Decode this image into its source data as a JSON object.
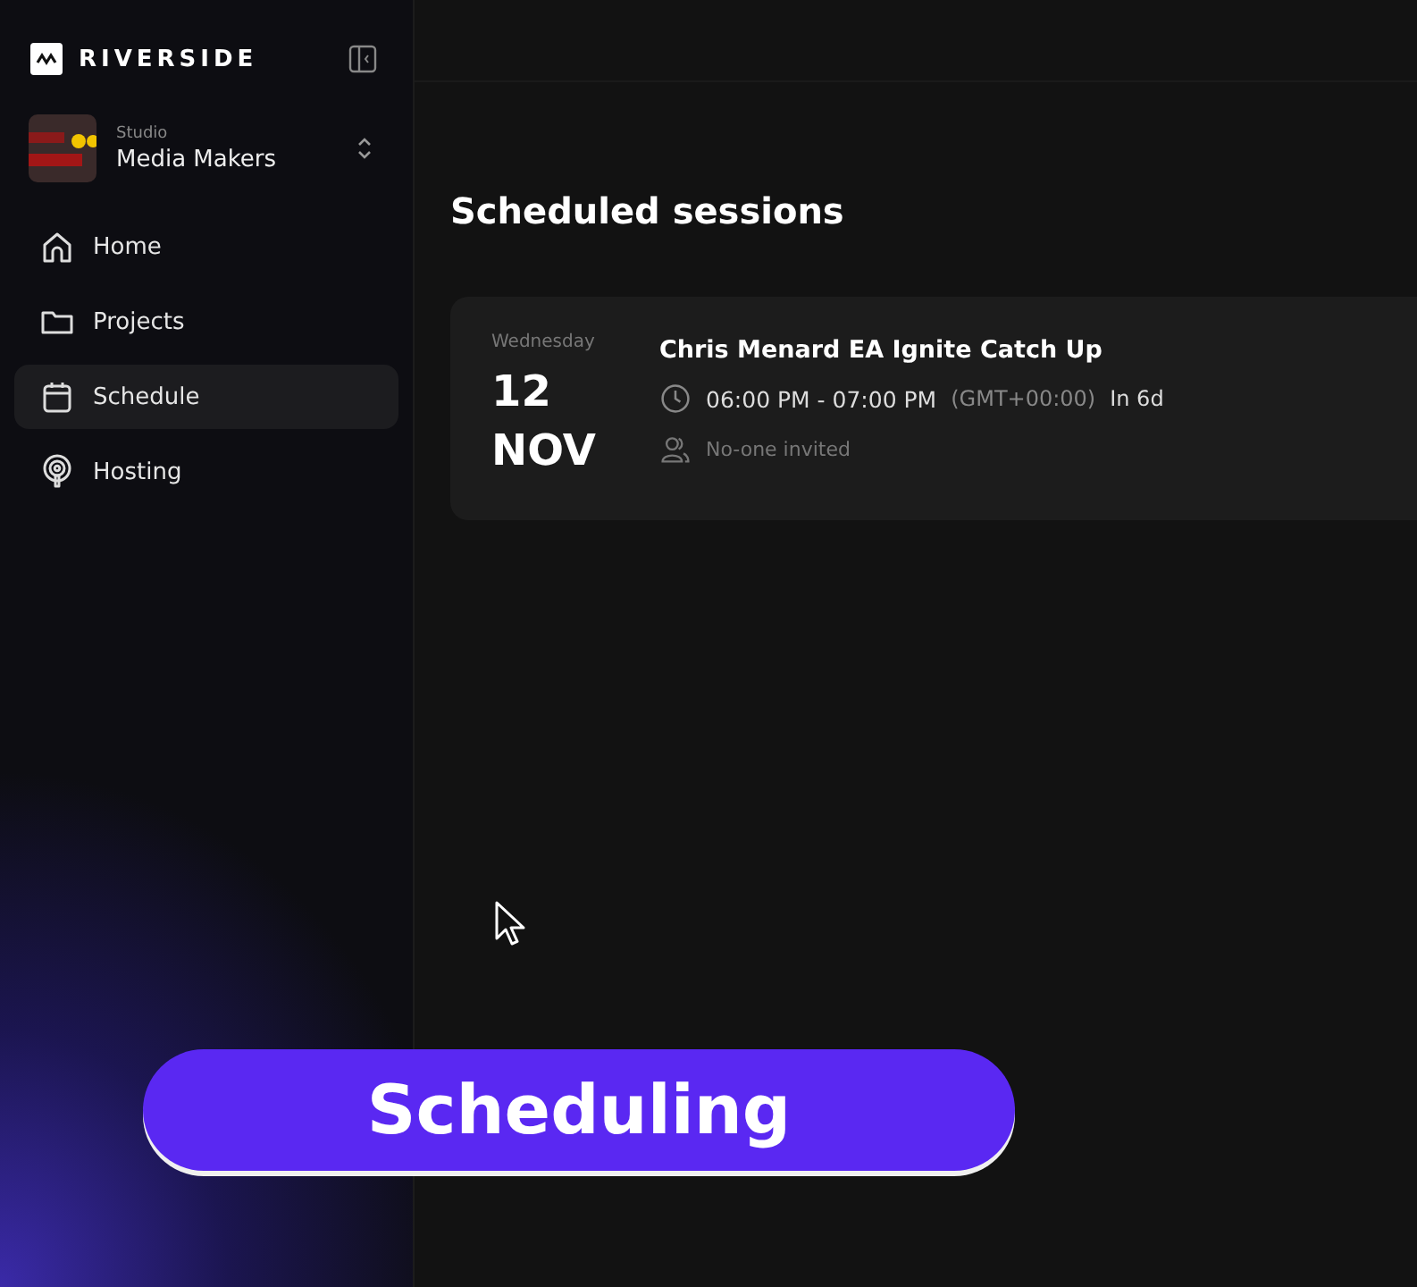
{
  "brand": {
    "name": "RIVERSIDE"
  },
  "studio": {
    "label": "Studio",
    "name": "Media Makers"
  },
  "nav": [
    {
      "label": "Home",
      "selected": false
    },
    {
      "label": "Projects",
      "selected": false
    },
    {
      "label": "Schedule",
      "selected": true
    },
    {
      "label": "Hosting",
      "selected": false
    }
  ],
  "page": {
    "title": "Scheduled sessions"
  },
  "sessions": [
    {
      "weekday": "Wednesday",
      "day": "12",
      "month": "NOV",
      "title": "Chris Menard EA Ignite Catch Up",
      "time": "06:00 PM - 07:00 PM",
      "timezone": "(GMT+00:00)",
      "relative": "In 6d",
      "invitees": "No-one invited"
    }
  ],
  "caption": {
    "text": "Scheduling"
  }
}
